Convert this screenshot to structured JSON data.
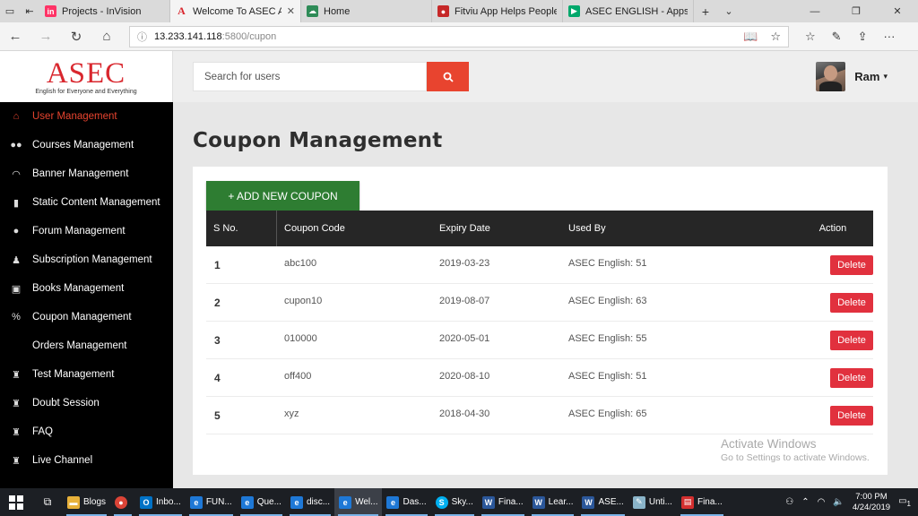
{
  "browser": {
    "tabs": [
      {
        "title": "Projects - InVision",
        "favicon": "In",
        "color": "#ff3366"
      },
      {
        "title": "Welcome To ASEC Adm",
        "favicon": "A",
        "color": "#ffffff",
        "active": true
      },
      {
        "title": "Home",
        "favicon": "cloud-icon",
        "color": "#2e8b57"
      },
      {
        "title": "Fitviu App Helps People to I",
        "favicon": "chat-icon",
        "color": "#c62828"
      },
      {
        "title": "ASEC ENGLISH - Apps on G",
        "favicon": "play-icon",
        "color": "#00a86b"
      }
    ],
    "address": {
      "host": "13.233.141.118",
      "path": ":5800/cupon"
    }
  },
  "logo": {
    "main": "ASEC",
    "sub": "English for Everyone and Everything"
  },
  "sidebar": {
    "items": [
      {
        "label": "User Management",
        "icon": "home-icon",
        "glyph": "⌂",
        "active": true
      },
      {
        "label": "Courses Management",
        "icon": "users-icon",
        "glyph": "👥"
      },
      {
        "label": "Banner Management",
        "icon": "headphones-icon",
        "glyph": "🎧"
      },
      {
        "label": "Static Content Management",
        "icon": "file-icon",
        "glyph": "▮"
      },
      {
        "label": "Forum Management",
        "icon": "comment-icon",
        "glyph": "💬"
      },
      {
        "label": "Subscription Management",
        "icon": "person-icon",
        "glyph": "♟"
      },
      {
        "label": "Books Management",
        "icon": "book-icon",
        "glyph": "▣"
      },
      {
        "label": "Coupon Management",
        "icon": "percent-icon",
        "glyph": "%"
      },
      {
        "label": "Orders Management",
        "icon": "",
        "glyph": ""
      },
      {
        "label": "Test Management",
        "icon": "trophy-icon",
        "glyph": "♜"
      },
      {
        "label": "Doubt Session",
        "icon": "trophy-icon",
        "glyph": "♜"
      },
      {
        "label": "FAQ",
        "icon": "trophy-icon",
        "glyph": "♜"
      },
      {
        "label": "Live Channel",
        "icon": "trophy-icon",
        "glyph": "♜"
      }
    ]
  },
  "topbar": {
    "search_placeholder": "Search for users",
    "user_name": "Ram"
  },
  "page": {
    "title": "Coupon Management",
    "add_button": "+ ADD NEW COUPON"
  },
  "table": {
    "headers": [
      "S No.",
      "Coupon Code",
      "Expiry Date",
      "Used By",
      "Action"
    ],
    "rows": [
      {
        "sno": "1",
        "code": "abc100",
        "expiry": "2019-03-23",
        "used_by": "ASEC English: 51",
        "action": "Delete"
      },
      {
        "sno": "2",
        "code": "cupon10",
        "expiry": "2019-08-07",
        "used_by": "ASEC English: 63",
        "action": "Delete"
      },
      {
        "sno": "3",
        "code": "010000",
        "expiry": "2020-05-01",
        "used_by": "ASEC English: 55",
        "action": "Delete"
      },
      {
        "sno": "4",
        "code": "off400",
        "expiry": "2020-08-10",
        "used_by": "ASEC English: 51",
        "action": "Delete"
      },
      {
        "sno": "5",
        "code": "xyz",
        "expiry": "2018-04-30",
        "used_by": "ASEC English: 65",
        "action": "Delete"
      }
    ]
  },
  "watermark": {
    "line1": "Activate Windows",
    "line2": "Go to Settings to activate Windows."
  },
  "taskbar": {
    "items": [
      {
        "label": "Blogs",
        "icon": "folder-icon",
        "color": "#e8b13a"
      },
      {
        "label": "",
        "icon": "chrome-icon",
        "color": "#db4437"
      },
      {
        "label": "Inbo...",
        "icon": "outlook-icon",
        "color": "#0072c6"
      },
      {
        "label": "FUN...",
        "icon": "edge-icon",
        "color": "#1e78d6"
      },
      {
        "label": "Que...",
        "icon": "edge-icon",
        "color": "#1e78d6"
      },
      {
        "label": "disc...",
        "icon": "edge-icon",
        "color": "#1e78d6"
      },
      {
        "label": "Wel...",
        "icon": "edge-icon",
        "color": "#1e78d6",
        "active": true
      },
      {
        "label": "Das...",
        "icon": "edge-icon",
        "color": "#1e78d6"
      },
      {
        "label": "Sky...",
        "icon": "skype-icon",
        "color": "#00aff0"
      },
      {
        "label": "Fina...",
        "icon": "word-icon",
        "color": "#2b579a"
      },
      {
        "label": "Lear...",
        "icon": "word-icon",
        "color": "#2b579a"
      },
      {
        "label": "ASE...",
        "icon": "word-icon",
        "color": "#2b579a"
      },
      {
        "label": "Unti...",
        "icon": "paint-icon",
        "color": "#8ab4c9"
      },
      {
        "label": "Fina...",
        "icon": "pdf-icon",
        "color": "#d32f2f"
      }
    ],
    "time": "7:00 PM",
    "date": "4/24/2019",
    "notification_count": "1"
  },
  "colors": {
    "accent": "#e8442f",
    "add_button": "#2e7d32",
    "delete_button": "#e1313e",
    "sidebar_bg": "#000000",
    "table_header": "#262626"
  }
}
